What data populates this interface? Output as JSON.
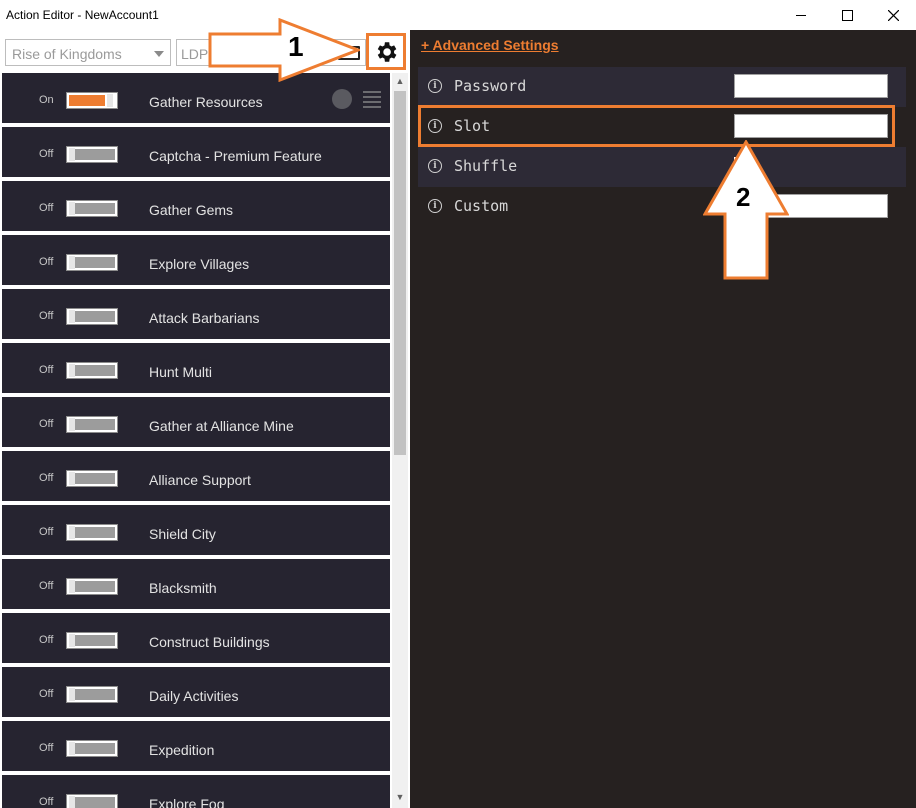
{
  "window": {
    "title": "Action Editor - NewAccount1"
  },
  "toolbar": {
    "game_select": "Rise of Kingdoms",
    "emulator_select": "LDP"
  },
  "actions": [
    {
      "state": "On",
      "label": "Gather Resources",
      "enabled": true
    },
    {
      "state": "Off",
      "label": "Captcha - Premium Feature",
      "enabled": false
    },
    {
      "state": "Off",
      "label": "Gather Gems",
      "enabled": false
    },
    {
      "state": "Off",
      "label": "Explore Villages",
      "enabled": false
    },
    {
      "state": "Off",
      "label": "Attack Barbarians",
      "enabled": false
    },
    {
      "state": "Off",
      "label": "Hunt Multi",
      "enabled": false
    },
    {
      "state": "Off",
      "label": "Gather at Alliance Mine",
      "enabled": false
    },
    {
      "state": "Off",
      "label": "Alliance Support",
      "enabled": false
    },
    {
      "state": "Off",
      "label": "Shield City",
      "enabled": false
    },
    {
      "state": "Off",
      "label": "Blacksmith",
      "enabled": false
    },
    {
      "state": "Off",
      "label": "Construct Buildings",
      "enabled": false
    },
    {
      "state": "Off",
      "label": "Daily Activities",
      "enabled": false
    },
    {
      "state": "Off",
      "label": "Expedition",
      "enabled": false
    },
    {
      "state": "Off",
      "label": "Explore Fog",
      "enabled": false
    }
  ],
  "settings": {
    "advanced_link": "+ Advanced Settings",
    "items": [
      {
        "name": "Password",
        "value": ""
      },
      {
        "name": "Slot",
        "value": ""
      },
      {
        "name": "Shuffle",
        "value": ""
      },
      {
        "name": "Custom",
        "value": ""
      }
    ]
  },
  "annotations": {
    "arrow1_label": "1",
    "arrow2_label": "2"
  },
  "colors": {
    "accent": "#ee7d31",
    "row_bg": "#262430",
    "panel_bg": "#262120"
  }
}
